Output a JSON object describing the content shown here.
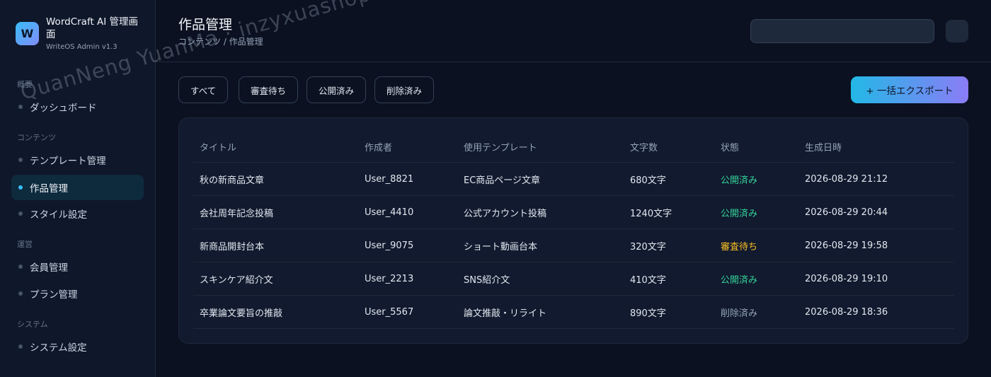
{
  "brand": {
    "logo_letter": "W",
    "title": "WordCraft AI 管理画面",
    "subtitle": "WriteOS Admin v1.3"
  },
  "sidebar": {
    "sections": [
      "概要",
      "コンテンツ",
      "運営",
      "システム"
    ],
    "items": [
      {
        "label": "ダッシュボード",
        "active": false
      },
      {
        "label": "テンプレート管理",
        "active": false
      },
      {
        "label": "作品管理",
        "active": true
      },
      {
        "label": "スタイル設定",
        "active": false
      },
      {
        "label": "会員管理",
        "active": false
      },
      {
        "label": "プラン管理",
        "active": false
      },
      {
        "label": "システム設定",
        "active": false
      }
    ]
  },
  "header": {
    "title": "作品管理",
    "breadcrumb": "コンテンツ / 作品管理",
    "search_value": ""
  },
  "filters": [
    "すべて",
    "審査待ち",
    "公開済み",
    "削除済み"
  ],
  "export_label": "+ 一括エクスポート",
  "table": {
    "columns": [
      "タイトル",
      "作成者",
      "使用テンプレート",
      "文字数",
      "状態",
      "生成日時"
    ],
    "rows": [
      {
        "title": "秋の新商品文章",
        "author": "User_8821",
        "template": "EC商品ページ文章",
        "chars": "680文字",
        "status": "公開済み",
        "status_key": "published",
        "date": "2026-08-29 21:12"
      },
      {
        "title": "会社周年記念投稿",
        "author": "User_4410",
        "template": "公式アカウント投稿",
        "chars": "1240文字",
        "status": "公開済み",
        "status_key": "published",
        "date": "2026-08-29 20:44"
      },
      {
        "title": "新商品開封台本",
        "author": "User_9075",
        "template": "ショート動画台本",
        "chars": "320文字",
        "status": "審査待ち",
        "status_key": "pending",
        "date": "2026-08-29 19:58"
      },
      {
        "title": "スキンケア紹介文",
        "author": "User_2213",
        "template": "SNS紹介文",
        "chars": "410文字",
        "status": "公開済み",
        "status_key": "published",
        "date": "2026-08-29 19:10"
      },
      {
        "title": "卒業論文要旨の推敲",
        "author": "User_5567",
        "template": "論文推敲・リライト",
        "chars": "890文字",
        "status": "削除済み",
        "status_key": "deleted",
        "date": "2026-08-29 18:36"
      }
    ]
  },
  "colors": {
    "published": "#34d399",
    "pending": "#fbbf24",
    "deleted": "#94a3b8",
    "accent": "#38bdf8"
  },
  "watermark": "QuanNeng YuanMa · inzyxuashop.com"
}
